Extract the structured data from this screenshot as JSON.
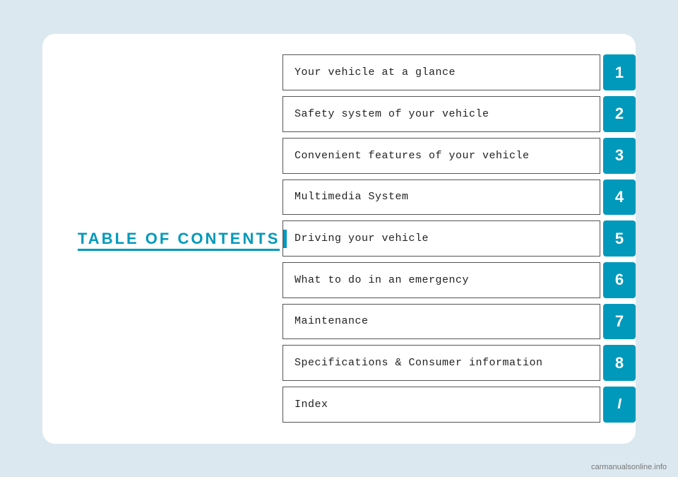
{
  "page": {
    "background_color": "#dce8f0"
  },
  "toc": {
    "title": "TABLE OF CONTENTS",
    "accent_color": "#0099bb",
    "items": [
      {
        "id": 1,
        "label": "Your vehicle at a glance",
        "number": "1"
      },
      {
        "id": 2,
        "label": "Safety system of your vehicle",
        "number": "2"
      },
      {
        "id": 3,
        "label": "Convenient features of your vehicle",
        "number": "3"
      },
      {
        "id": 4,
        "label": "Multimedia System",
        "number": "4"
      },
      {
        "id": 5,
        "label": "Driving your vehicle",
        "number": "5"
      },
      {
        "id": 6,
        "label": "What to do in an emergency",
        "number": "6"
      },
      {
        "id": 7,
        "label": "Maintenance",
        "number": "7"
      },
      {
        "id": 8,
        "label": "Specifications & Consumer information",
        "number": "8"
      },
      {
        "id": 9,
        "label": "Index",
        "number": "I",
        "index_style": true
      }
    ]
  },
  "watermark": {
    "text": "carmanualsonline.info"
  }
}
